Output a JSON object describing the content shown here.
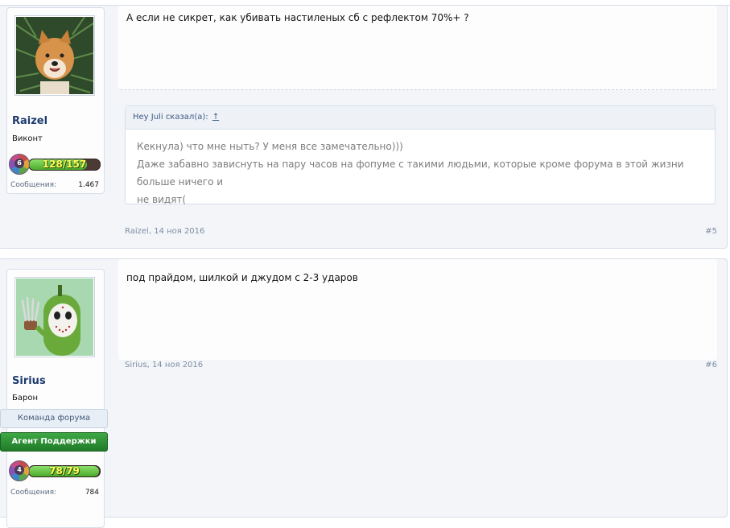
{
  "posts": [
    {
      "user": {
        "name": "Raizel",
        "title": "Виконт",
        "level": "6",
        "xp": "128/157",
        "xp_fraction": 0.815,
        "messages_label": "Сообщения:",
        "messages": "1.467",
        "avatar": "shiba-inu-dog-in-pine-branches"
      },
      "message": "А если не сикрет, как убивать настиленых сб с рефлектом 70%+ ?",
      "quote": {
        "author": "Hey Juli",
        "said": "сказал(а):",
        "arrow": "↑",
        "lines": [
          "Кекнула) что мне ныть? У меня все замечательно)))",
          "Даже забавно зависнуть на пару часов на фопуме с такими людьми, которые кроме форума в этой жизни больше ничего и",
          "не видят("
        ]
      },
      "author_meta": "Raizel",
      "date": "14 ноя 2016",
      "number": "#5"
    },
    {
      "user": {
        "name": "Sirius",
        "title": "Барон",
        "badges": [
          "Команда форума",
          "Агент Поддержки"
        ],
        "level": "4",
        "xp": "78/79",
        "xp_fraction": 0.987,
        "messages_label": "Сообщения:",
        "messages": "784",
        "avatar": "green-cartoon-character-hockey-mask-claw"
      },
      "message": "под прайдом, шилкой и джудом с 2-3 ударов",
      "author_meta": "Sirius",
      "date": "14 ноя 2016",
      "number": "#6"
    }
  ],
  "colors": {
    "username": "#1d3b6e",
    "support_badge": "#2e8f36",
    "team_badge": "#e8eef5",
    "xp_text": "#ffff55"
  }
}
